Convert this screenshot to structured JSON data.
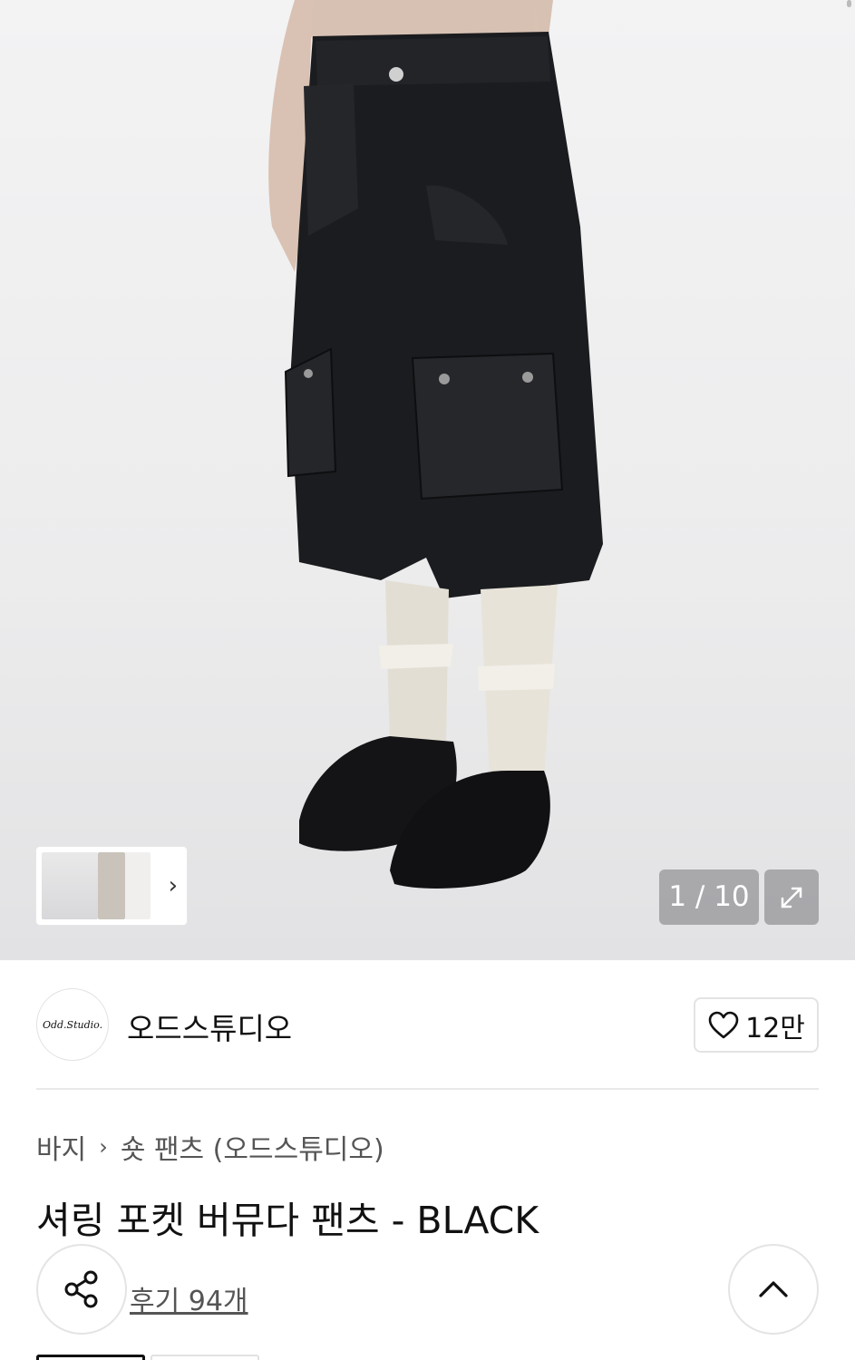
{
  "gallery": {
    "counter": "1 / 10",
    "expand_icon": "expand-icon",
    "thumbnail_arrow_icon": "chevron-right-icon"
  },
  "brand": {
    "logo_text": "Odd.Studio.",
    "name": "오드스튜디오"
  },
  "like": {
    "icon": "heart-icon",
    "count": "12만"
  },
  "breadcrumb": {
    "items": [
      "바지",
      "숏 팬츠 (오드스튜디오)"
    ],
    "separator_icon": "chevron-right-icon"
  },
  "product": {
    "title": "셔링 포켓 버뮤다 팬츠 - BLACK",
    "reviews": "후기 94개"
  },
  "actions": {
    "share_icon": "share-icon",
    "top_icon": "chevron-up-icon"
  }
}
